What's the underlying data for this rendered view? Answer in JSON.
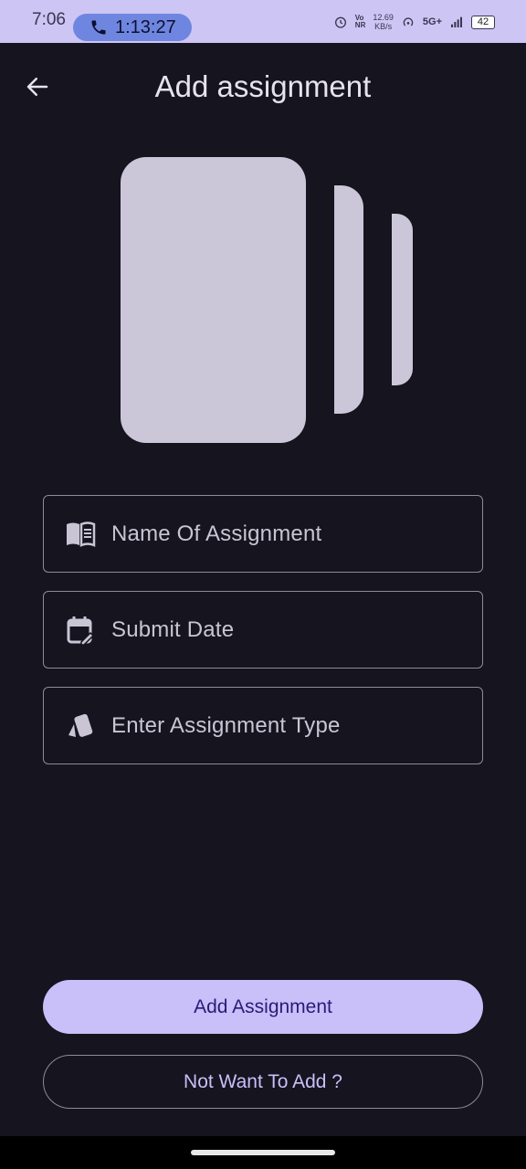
{
  "status_bar": {
    "time": "7:06",
    "call_timer": "1:13:27",
    "net_speed_value": "12.69",
    "net_speed_unit": "KB/s",
    "network": "5G+",
    "battery": "42",
    "icons": [
      "phone-icon",
      "alarm-icon",
      "volte-icon",
      "hotspot-icon",
      "signal-icon",
      "battery-icon"
    ]
  },
  "header": {
    "title": "Add assignment",
    "back_icon": "arrow-back-icon"
  },
  "form": {
    "name_field": {
      "placeholder": "Name Of Assignment",
      "icon": "book-icon"
    },
    "date_field": {
      "placeholder": "Submit Date",
      "icon": "calendar-edit-icon"
    },
    "type_field": {
      "placeholder": "Enter Assignment Type",
      "icon": "cards-icon"
    }
  },
  "actions": {
    "add_label": "Add Assignment",
    "cancel_label": "Not Want To Add ?"
  },
  "colors": {
    "background": "#15141f",
    "status_bar": "#cdc5f4",
    "primary": "#c9bff9",
    "on_primary": "#2b1a77",
    "illustration": "#cbc7d8",
    "outline": "#8e8a9a"
  }
}
